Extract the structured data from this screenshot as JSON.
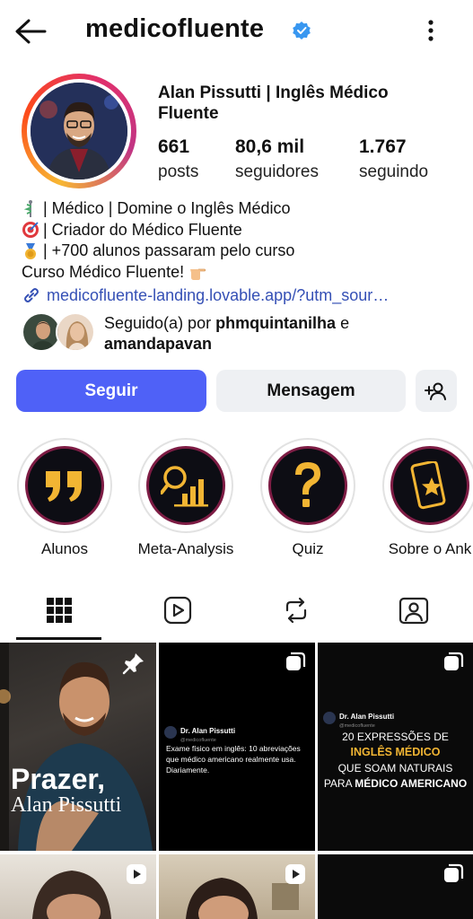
{
  "header": {
    "username": "medicofluente",
    "icons": {
      "back": "arrow-left-icon",
      "verified": "verified-badge-icon",
      "more": "more-vertical-icon"
    }
  },
  "profile": {
    "full_name": "Alan Pissutti | Inglês Médico Fluente",
    "stats": [
      {
        "value": "661",
        "label": "posts"
      },
      {
        "value": "80,6 mil",
        "label": "seguidores"
      },
      {
        "value": "1.767",
        "label": "seguindo"
      }
    ],
    "bio": [
      {
        "icon": "medical-symbol-icon",
        "text": "| Médico | Domine o Inglês Médico"
      },
      {
        "icon": "target-icon",
        "text": "| Criador do Médico Fluente"
      },
      {
        "icon": "medal-icon",
        "text": "| +700 alunos passaram pelo curso"
      },
      {
        "icon": "pointing-hand-icon",
        "text": "Curso Médico Fluente!"
      }
    ],
    "link": "medicofluente-landing.lovable.app/?utm_sour…",
    "followed_by": {
      "prefix": "Seguido(a) por ",
      "user1": "phmquintanilha",
      "joiner": " e",
      "user2": "amandapavan"
    }
  },
  "actions": {
    "follow_label": "Seguir",
    "message_label": "Mensagem",
    "add_icon": "add-person-icon"
  },
  "highlights": [
    {
      "label": "Alunos",
      "icon": "quote-icon"
    },
    {
      "label": "Meta-Analysis",
      "icon": "magnifier-chart-icon"
    },
    {
      "label": "Quiz",
      "icon": "question-mark-icon"
    },
    {
      "label": "Sobre o Ank",
      "icon": "phone-star-icon"
    }
  ],
  "tabs": [
    {
      "name": "grid",
      "icon": "grid-icon",
      "active": true
    },
    {
      "name": "reels",
      "icon": "reels-icon",
      "active": false
    },
    {
      "name": "reposts",
      "icon": "repost-icon",
      "active": false
    },
    {
      "name": "tagged",
      "icon": "tagged-icon",
      "active": false
    }
  ],
  "posts": {
    "p1": {
      "title": "Prazer,",
      "subtitle": "Alan Pissutti"
    },
    "p2": {
      "author": "Dr. Alan Pissutti",
      "handle": "@medicofluente",
      "text": "Exame físico em inglês: 10 abreviações que médico americano realmente usa. Diariamente."
    },
    "p3": {
      "author": "Dr. Alan Pissutti",
      "handle": "@medicofluente",
      "line1": "20 EXPRESSÕES DE",
      "line2": "INGLÊS MÉDICO",
      "line3": "QUE SOAM NATURAIS",
      "line4_prefix": "PARA ",
      "line4_bold": "MÉDICO AMERICANO"
    }
  },
  "colors": {
    "accent": "#4f61f7",
    "link": "#3550b5",
    "secondary_button": "#eef0f3",
    "highlight_gold": "#f2b533"
  }
}
